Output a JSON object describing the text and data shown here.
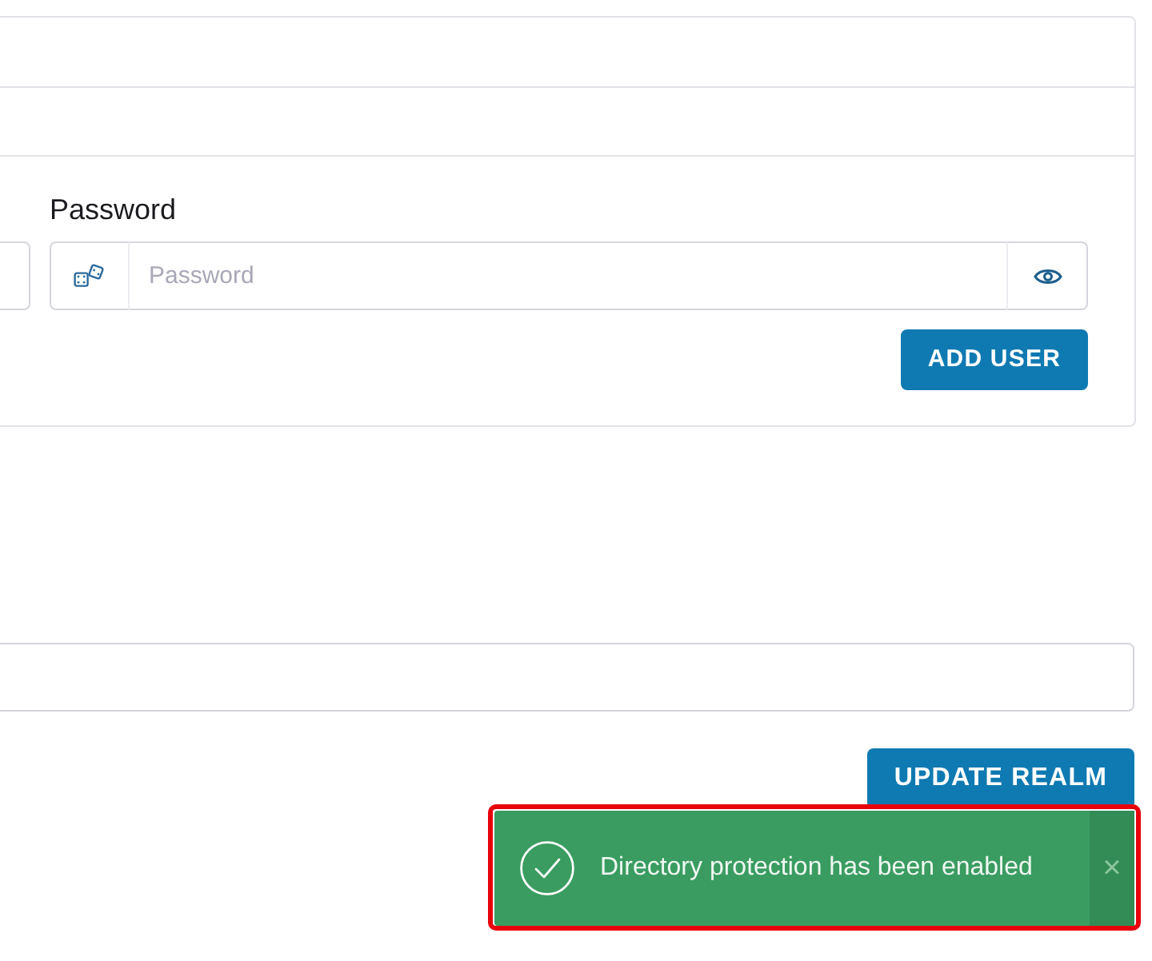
{
  "user_form": {
    "password_field": {
      "label": "Password",
      "placeholder": "Password"
    },
    "add_button": "ADD USER"
  },
  "realm_form": {
    "update_button": "UPDATE REALM"
  },
  "toast": {
    "kind": "success",
    "message": "Directory protection has been enabled",
    "close_label": "×",
    "highlighted": true
  }
}
